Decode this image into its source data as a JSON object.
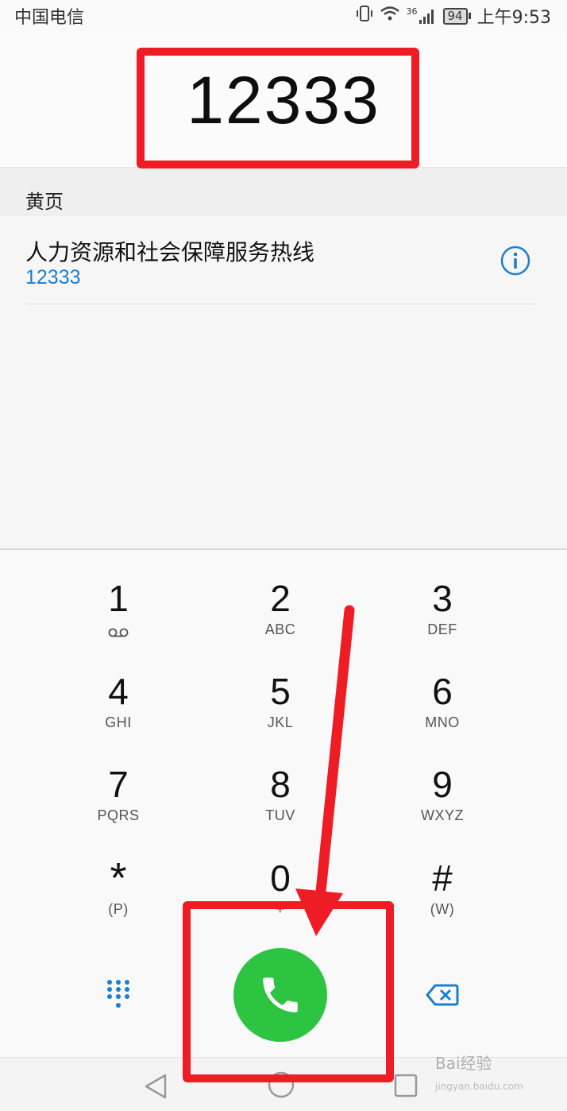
{
  "status_bar": {
    "carrier": "中国电信",
    "network": "36",
    "battery": "94",
    "time": "上午9:53",
    "icons": [
      "vibrate-icon",
      "wifi-icon",
      "signal-icon",
      "battery-icon"
    ]
  },
  "dialer": {
    "number": "12333"
  },
  "yellow_pages": {
    "header": "黄页",
    "result": {
      "name": "人力资源和社会保障服务热线",
      "number": "12333"
    }
  },
  "keypad": {
    "keys": [
      {
        "digit": "1",
        "letters": "ꝏ"
      },
      {
        "digit": "2",
        "letters": "ABC"
      },
      {
        "digit": "3",
        "letters": "DEF"
      },
      {
        "digit": "4",
        "letters": "GHI"
      },
      {
        "digit": "5",
        "letters": "JKL"
      },
      {
        "digit": "6",
        "letters": "MNO"
      },
      {
        "digit": "7",
        "letters": "PQRS"
      },
      {
        "digit": "8",
        "letters": "TUV"
      },
      {
        "digit": "9",
        "letters": "WXYZ"
      },
      {
        "digit": "*",
        "letters": "(P)"
      },
      {
        "digit": "0",
        "letters": "+"
      },
      {
        "digit": "#",
        "letters": "(W)"
      }
    ],
    "actions": [
      "dialpad-icon",
      "call-icon",
      "backspace-icon"
    ]
  },
  "nav_bar": {
    "buttons": [
      "back-icon",
      "home-icon",
      "recent-apps-icon"
    ]
  },
  "colors": {
    "accent_blue": "#1b7fd1",
    "call_green": "#2dc442",
    "annotation_red": "#ee1c25"
  },
  "watermark": {
    "text": "Bai经验",
    "sub": "jingyan.baidu.com"
  }
}
